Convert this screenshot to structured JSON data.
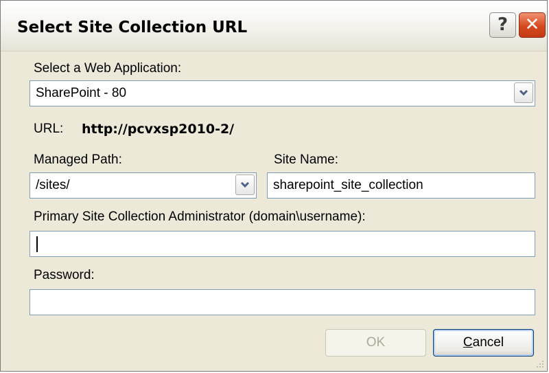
{
  "dialog": {
    "title": "Select Site Collection URL",
    "help_label": "?",
    "close_label": "✕"
  },
  "web_application": {
    "label": "Select a Web Application:",
    "selected": "SharePoint - 80"
  },
  "url": {
    "label": "URL:",
    "value": "http://pcvxsp2010-2/"
  },
  "managed_path": {
    "label": "Managed Path:",
    "selected": "/sites/"
  },
  "site_name": {
    "label": "Site Name:",
    "value": "sharepoint_site_collection"
  },
  "admin": {
    "label": "Primary Site Collection Administrator (domain\\username):",
    "value": ""
  },
  "password": {
    "label": "Password:",
    "value": ""
  },
  "buttons": {
    "ok_label": "OK",
    "cancel_mnemonic": "C",
    "cancel_rest": "ancel"
  },
  "colors": {
    "dialog_bg": "#ece9d8",
    "field_border": "#7f9db9",
    "close_button": "#d44a1e",
    "disabled_text": "#aca899"
  }
}
